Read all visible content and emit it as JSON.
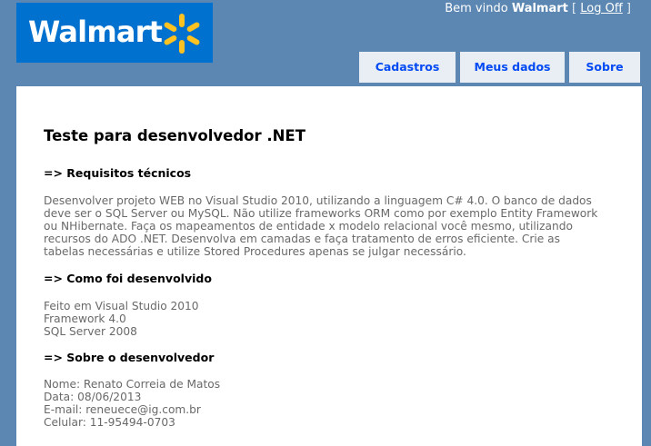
{
  "logo": {
    "text": "Walmart",
    "accent": "#ffc220",
    "brand": "#0071ce"
  },
  "login": {
    "welcome": "Bem vindo",
    "user": "Walmart",
    "open_bracket": "[",
    "logoff": "Log Off",
    "close_bracket": "]"
  },
  "menu": {
    "items": [
      {
        "label": "Cadastros"
      },
      {
        "label": "Meus dados"
      },
      {
        "label": "Sobre"
      }
    ]
  },
  "main": {
    "title": "Teste para desenvolvedor .NET",
    "sections": [
      {
        "heading": "=> Requisitos técnicos",
        "lines": [
          "Desenvolver projeto WEB no Visual Studio 2010, utilizando a linguagem C# 4.0. O banco de dados",
          "deve ser o SQL Server ou MySQL. Não utilize frameworks ORM como por exemplo Entity Framework",
          "ou NHibernate. Faça os mapeamentos de entidade x modelo relacional você mesmo, utilizando",
          "recursos do ADO .NET. Desenvolva em camadas e faça tratamento de erros eficiente. Crie as",
          "tabelas necessárias e utilize Stored Procedures apenas se julgar necessário."
        ]
      },
      {
        "heading": "=> Como foi desenvolvido",
        "lines": [
          "Feito em Visual Studio 2010",
          "Framework 4.0",
          "SQL Server 2008"
        ]
      },
      {
        "heading": "=> Sobre o desenvolvedor",
        "lines": [
          "Nome: Renato Correia de Matos",
          "Data: 08/06/2013",
          "E-mail: reneuece@ig.com.br",
          "Celular: 11-95494-0703"
        ]
      }
    ]
  }
}
